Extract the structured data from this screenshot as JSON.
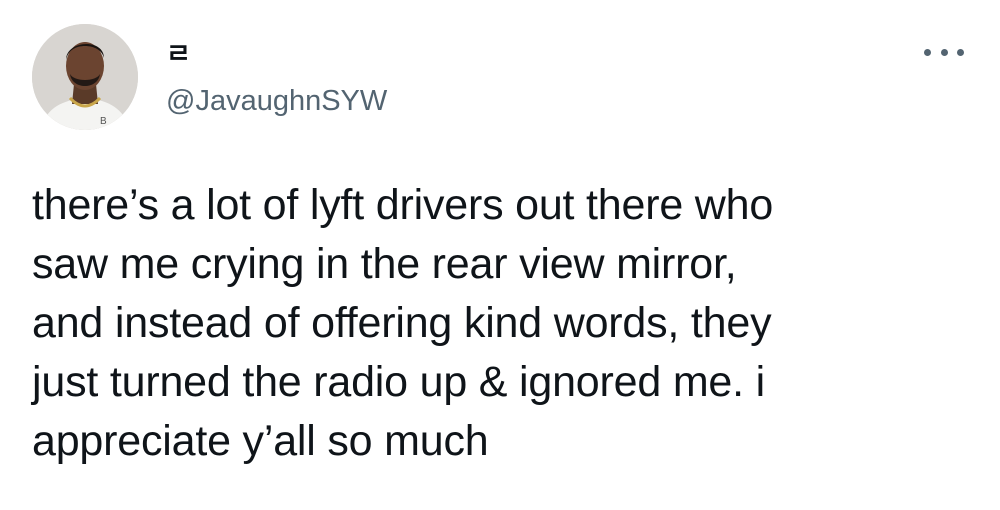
{
  "tweet": {
    "author": {
      "display_name": "ㄹ",
      "handle": "@JavaughnSYW",
      "avatar": "profile-photo"
    },
    "more_icon": "more-horizontal-icon",
    "text": "there’s a lot of lyft drivers out there who\nsaw me crying in the rear view mirror,\nand instead of offering kind words, they\njust turned the radio up & ignored me. i\nappreciate y’all so much"
  },
  "colors": {
    "text": "#0f1419",
    "secondary": "#536471",
    "background": "#ffffff"
  }
}
